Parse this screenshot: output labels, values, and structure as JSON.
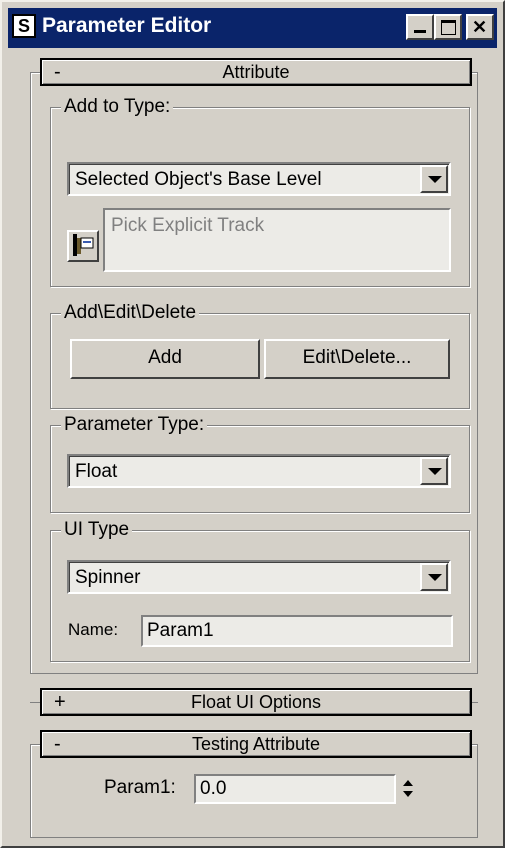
{
  "window": {
    "title": "Parameter Editor",
    "app_icon": "S",
    "buttons": [
      "minimize-icon",
      "maximize-icon",
      "close-icon"
    ]
  },
  "attribute_rollout": {
    "sign": "-",
    "label": "Attribute",
    "add_to_type": {
      "title": "Add to Type:",
      "selected": "Selected Object's Base Level",
      "pick_placeholder": "Pick Explicit Track"
    },
    "add_edit_delete": {
      "title": "Add\\Edit\\Delete",
      "add_label": "Add",
      "edit_delete_label": "Edit\\Delete..."
    },
    "parameter_type": {
      "title": "Parameter Type:",
      "selected": "Float"
    },
    "ui_type": {
      "title": "UI Type",
      "selected": "Spinner",
      "name_label": "Name:",
      "name_value": "Param1"
    }
  },
  "float_ui_rollout": {
    "sign": "+",
    "label": "Float UI Options"
  },
  "testing_rollout": {
    "sign": "-",
    "label": "Testing Attribute",
    "param_label": "Param1:",
    "param_value": "0.0"
  }
}
